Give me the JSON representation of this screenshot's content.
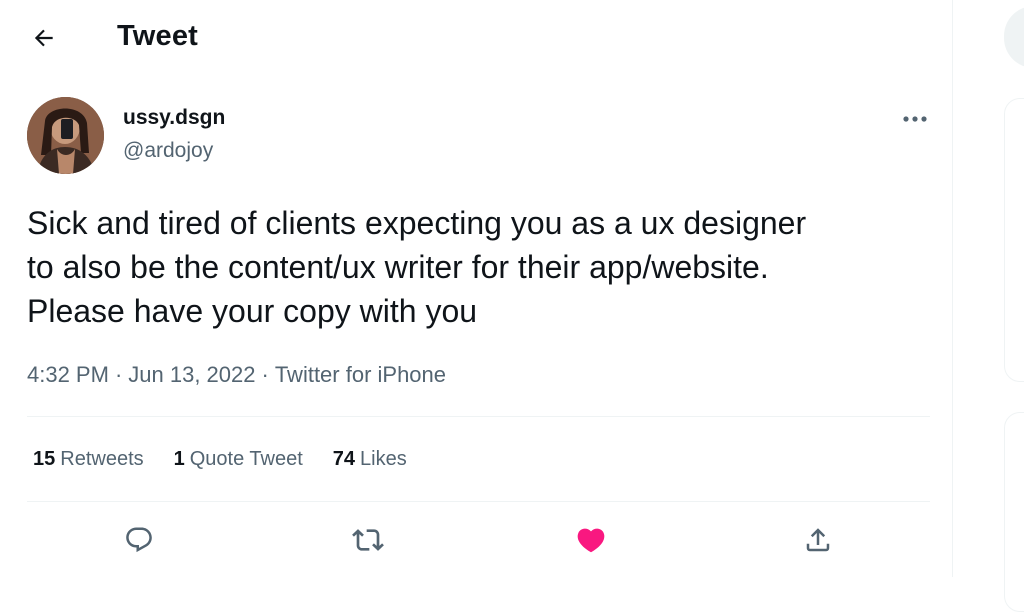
{
  "header": {
    "title": "Tweet",
    "back_icon": "arrow-left-icon"
  },
  "tweet": {
    "author": {
      "name": "ussy.dsgn",
      "handle": "@ardojoy",
      "avatar_icon": "avatar-photo"
    },
    "text": "Sick and tired of clients expecting you as a ux designer\nto also be the content/ux writer for their app/website.\nPlease have your copy with you",
    "time": "4:32 PM",
    "date": "Jun 13, 2022",
    "source": "Twitter for iPhone",
    "separator": "·",
    "more_icon": "more-icon"
  },
  "stats": {
    "retweets": {
      "count": "15",
      "label": "Retweets"
    },
    "quotes": {
      "count": "1",
      "label": "Quote Tweet"
    },
    "likes": {
      "count": "74",
      "label": "Likes"
    }
  },
  "actions": {
    "reply_icon": "reply-icon",
    "retweet_icon": "retweet-icon",
    "like_icon": "heart-icon",
    "share_icon": "share-icon",
    "like_color": "#f91880",
    "icon_color": "#536471"
  }
}
